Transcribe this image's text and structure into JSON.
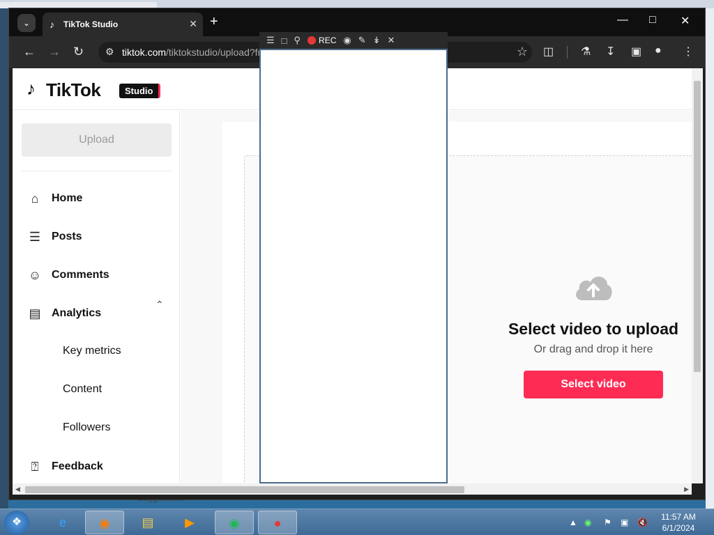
{
  "browser": {
    "tab_title": "TikTok Studio",
    "url_host": "tiktok.com",
    "url_path": "/tiktokstudio/upload?from=upload"
  },
  "recorder": {
    "rec_label": "REC"
  },
  "header": {
    "logo_text": "TikTok",
    "badge": "Studio"
  },
  "sidebar": {
    "upload_label": "Upload",
    "items": [
      {
        "label": "Home"
      },
      {
        "label": "Posts"
      },
      {
        "label": "Comments"
      },
      {
        "label": "Analytics"
      },
      {
        "label": "Key metrics"
      },
      {
        "label": "Content"
      },
      {
        "label": "Followers"
      },
      {
        "label": "Feedback"
      }
    ]
  },
  "main": {
    "title": "Select video to upload",
    "subtitle": "Or drag and drop it here",
    "button": "Select video"
  },
  "behind": {
    "text": "Suggestions"
  },
  "taskbar": {
    "time": "11:57 AM",
    "date": "6/1/2024"
  },
  "colors": {
    "accent": "#fe2c55"
  }
}
